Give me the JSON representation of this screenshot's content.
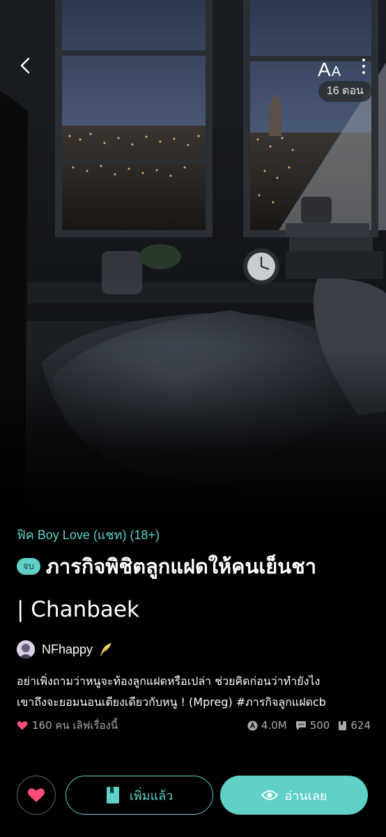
{
  "header": {
    "font_size_big": "A",
    "font_size_small": "A",
    "episodes": "16 ตอน"
  },
  "story": {
    "category": "ฟิค Boy Love (แชท) (18+)",
    "status_badge": "จบ",
    "title_line1": "ภารกิจพิชิตลูกแฝดให้คนเย็นชา",
    "title_line2": "| Chanbaek",
    "author": "NFhappy",
    "synopsis_line1": "อย่าเพิ่งถามว่าหนูจะท้องลูกแฝดหรือเปล่า ช่วยคิดก่อนว่าทำยังไง",
    "synopsis_line2": "เขาถึงจะยอมนอนเตียงเดียวกับหนู ! (Mpreg) #ภารกิจลูกแฝดcb",
    "likes": "160 คน เลิฟเรื่องนี้",
    "views": "4.0M",
    "comments": "500",
    "chapters": "624"
  },
  "actions": {
    "add_label": "เพิ่มแล้ว",
    "read_label": "อ่านเลย"
  },
  "colors": {
    "accent": "#5fd1c7",
    "heart": "#ff4d7a",
    "background": "#000000"
  },
  "icons": [
    "back-icon",
    "font-size-icon",
    "more-icon",
    "quill-icon",
    "heart-icon",
    "views-icon",
    "comments-icon",
    "chapters-icon",
    "bookmark-icon",
    "eye-icon"
  ]
}
